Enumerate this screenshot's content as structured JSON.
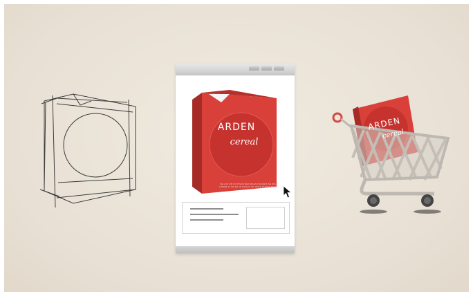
{
  "product": {
    "brand": "ARDEN",
    "subtitle": "cereal",
    "fine_print": "SE LOC DD IN IR SUR RES MAGNI MAGNIS SE NIS A LOREM AT DE EM IN ERNAM HE OPRE PULPIS SOCIIS"
  },
  "cart_box": {
    "brand": "ARDEN",
    "subtitle": "cereal"
  },
  "colors": {
    "background": "#ebe4d9",
    "box_red": "#d9403a",
    "box_dark": "#a62a25",
    "sketch": "#3a3a3a",
    "cart_metal": "#c9c4bd"
  },
  "icons": [
    "box-sketch-icon",
    "mouse-cursor-icon",
    "shopping-cart-icon"
  ]
}
